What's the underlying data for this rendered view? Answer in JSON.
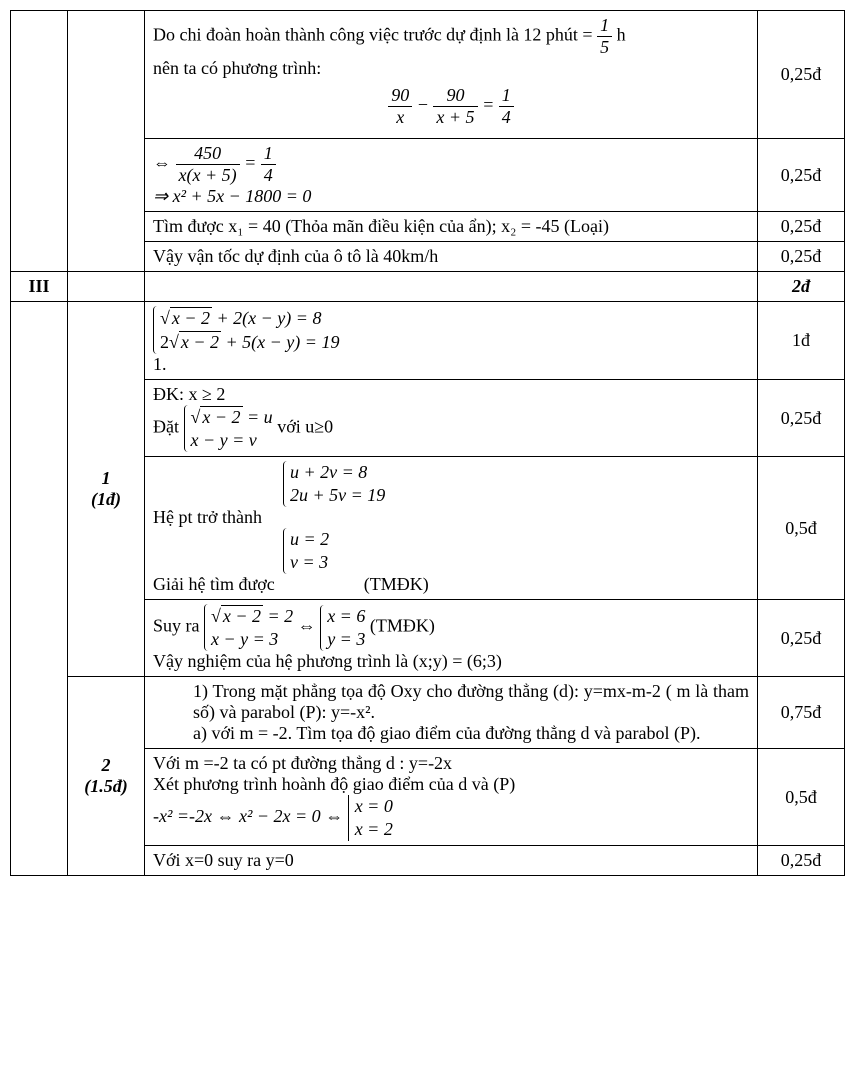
{
  "rows": {
    "r1": {
      "line1_pre": "Do chi đoàn hoàn thành công việc trước dự định là 12 phút = ",
      "frac1_num": "1",
      "frac1_den": "5",
      "line1_post": " h",
      "line2": "nên ta có phương trình:",
      "eq_f1_num": "90",
      "eq_f1_den": "x",
      "eq_f2_num": "90",
      "eq_f2_den": "x + 5",
      "eq_f3_num": "1",
      "eq_f3_den": "4",
      "score": "0,25đ"
    },
    "r2": {
      "arrow1": "⇔ ",
      "f1_num": "450",
      "f1_den": "x(x + 5)",
      "eq": " = ",
      "f2_num": "1",
      "f2_den": "4",
      "arrow2": "⇒ ",
      "eq2": "x² + 5x − 1800 = 0",
      "score": "0,25đ"
    },
    "r3": {
      "text": "Tìm được x₁ = 40 (Thỏa mãn điều kiện của ẩn); x₂ = -45 (Loại)",
      "score": "0,25đ"
    },
    "r4": {
      "text": "Vậy vận tốc dự định của ô tô là 40km/h",
      "score": "0,25đ"
    },
    "r5": {
      "label": "III",
      "score": "2đ"
    },
    "r6": {
      "sublabel_line1": "1",
      "sublabel_line2": "(1đ)",
      "sys1_a_pre": "√",
      "sys1_a_sqrt": "x − 2",
      "sys1_a_post": " + 2(x − y) = 8",
      "sys1_b_pre": "2√",
      "sys1_b_sqrt": "x − 2",
      "sys1_b_post": " + 5(x − y) = 19",
      "trailing": "1.",
      "score": "1đ"
    },
    "r7": {
      "line1": "ĐK: x ≥ 2",
      "line2_pre": "Đặt ",
      "sys_a_pre": "√",
      "sys_a_sqrt": "x − 2",
      "sys_a_post": " = u",
      "sys_b": "x − y = v",
      "line2_post": " với u≥0",
      "score": "0,25đ"
    },
    "r8": {
      "sys1_a": "u + 2v = 8",
      "sys1_b": "2u + 5v = 19",
      "text1": "Hệ pt trở thành",
      "sys2_a": "u = 2",
      "sys2_b": "v = 3",
      "text2_pre": "Giải hệ tìm được",
      "text2_post": "(TMĐK)",
      "score": "0,5đ"
    },
    "r9": {
      "pre": "Suy ra ",
      "sysA_a_pre": "√",
      "sysA_a_sqrt": "x − 2",
      "sysA_a_post": " = 2",
      "sysA_b": "x − y = 3",
      "mid": " ⇔ ",
      "sysB_a": "x = 6",
      "sysB_b": "y = 3",
      "post": "(TMĐK)",
      "line2": "Vậy nghiệm của hệ phương trình là (x;y) = (6;3)",
      "score": "0,25đ"
    },
    "r10": {
      "sublabel_line1": "2",
      "sublabel_line2": "(1.5đ)",
      "item1_pre": "1)  ",
      "item1_text": "Trong mặt phẳng tọa độ Oxy cho đường thẳng (d): y=mx-m-2 ( m là tham số) và parabol (P): y=-x².",
      "itema_pre": "a)  ",
      "itema_text": "với m = -2. Tìm tọa độ giao điểm của đường thẳng d và parabol (P).",
      "score": "0,75đ"
    },
    "r11": {
      "line1": "Với m =-2 ta có pt đường thẳng d : y=-2x",
      "line2": "Xét phương trình hoành độ giao điểm của d và (P)",
      "line3_pre": "-x² =-2x ⇔ ",
      "line3_eq": "x² − 2x = 0",
      "line3_mid": " ⇔ ",
      "sys_a": "x = 0",
      "sys_b": "x = 2",
      "score": "0,5đ"
    },
    "r12": {
      "text": "Với x=0 suy ra y=0",
      "score": "0,25đ"
    }
  }
}
